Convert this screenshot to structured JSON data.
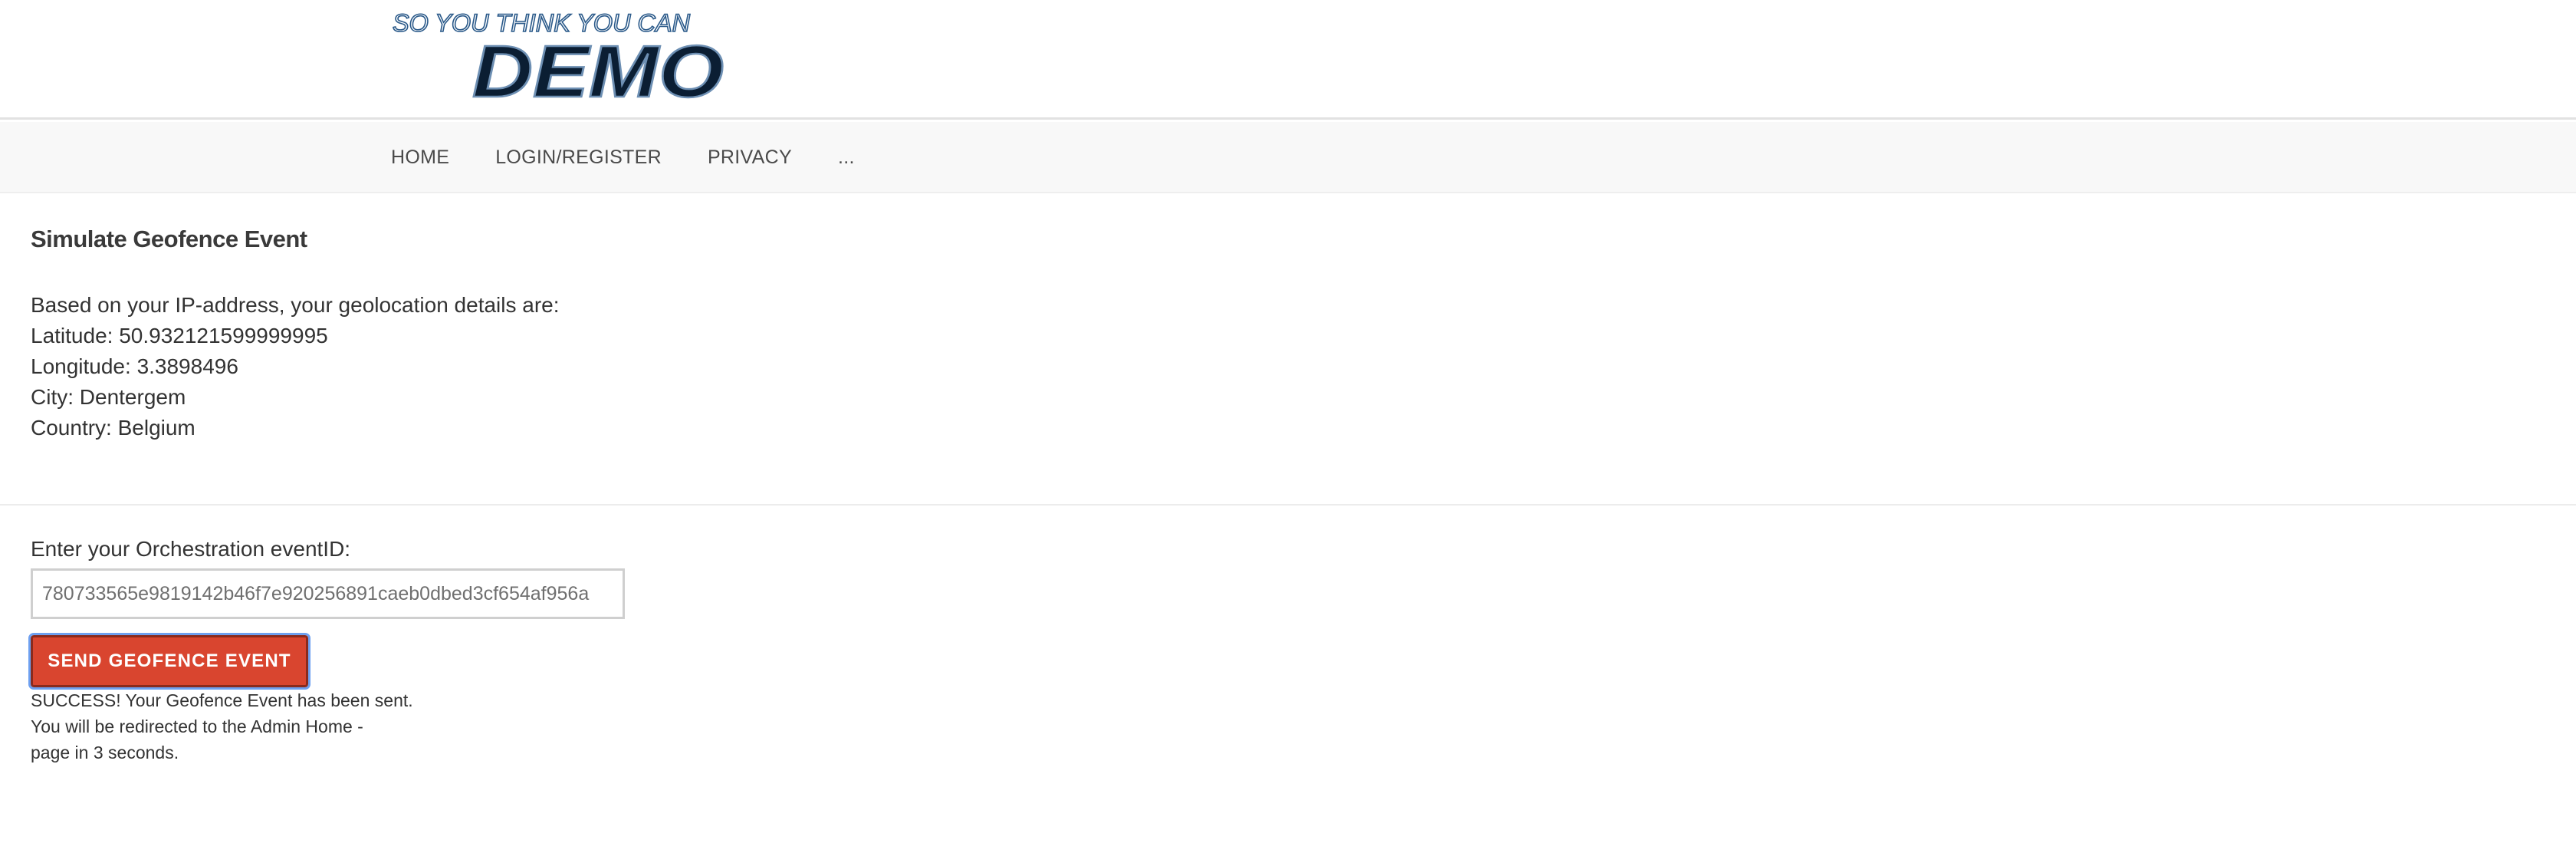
{
  "header": {
    "logo": {
      "top_text": "SO YOU THINK YOU CAN",
      "main_text": "DEMO"
    }
  },
  "nav": {
    "items": [
      {
        "label": "HOME"
      },
      {
        "label": "LOGIN/REGISTER"
      },
      {
        "label": "PRIVACY"
      },
      {
        "label": "..."
      }
    ]
  },
  "main": {
    "title": "Simulate Geofence Event",
    "geo_intro": "Based on your IP-address, your geolocation details are:",
    "latitude": "Latitude: 50.932121599999995",
    "longitude": "Longitude: 3.3898496",
    "city": "City: Dentergem",
    "country": "Country: Belgium",
    "event_label": "Enter your Orchestration eventID:",
    "event_value": "780733565e9819142b46f7e920256891caeb0dbed3cf654af956a",
    "send_label": "SEND GEOFENCE EVENT",
    "success_lines": [
      "SUCCESS! Your Geofence Event has been sent.",
      "You will be redirected to the Admin Home -",
      "page in 3 seconds."
    ]
  },
  "colors": {
    "button": "#d9452f",
    "logo_dark": "#0b1e33",
    "logo_outline": "#2b5a8a",
    "nav_bg": "#f8f8f8"
  }
}
